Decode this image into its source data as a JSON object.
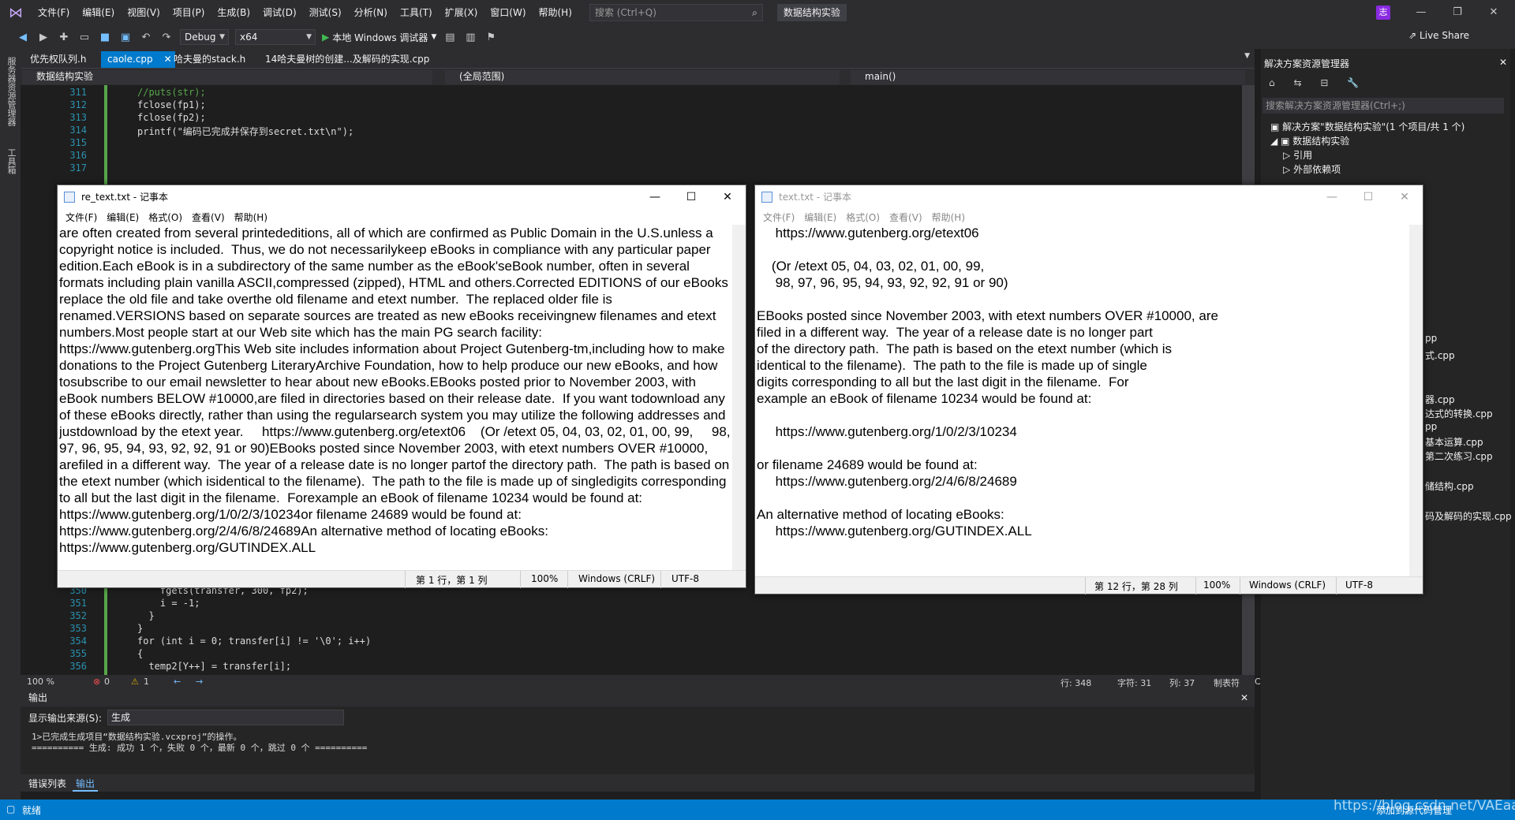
{
  "menu": {
    "items": [
      "文件(F)",
      "编辑(E)",
      "视图(V)",
      "项目(P)",
      "生成(B)",
      "调试(D)",
      "测试(S)",
      "分析(N)",
      "工具(T)",
      "扩展(X)",
      "窗口(W)",
      "帮助(H)"
    ],
    "search_placeholder": "搜索 (Ctrl+Q)",
    "project_badge": "数据结构实验",
    "user_initial": "志"
  },
  "toolbar": {
    "config": "Debug",
    "platform": "x64",
    "run_label": "本地 Windows 调试器",
    "live_share": "Live Share"
  },
  "left_rail": {
    "server_explorer": "服务器资源管理器",
    "toolbox": "工具箱"
  },
  "tabs": [
    {
      "label": "优先权队列.h"
    },
    {
      "label": "caole.cpp"
    },
    {
      "label": "哈夫曼的stack.h"
    },
    {
      "label": "14哈夫曼树的创建...及解码的实现.cpp"
    }
  ],
  "navbar": {
    "project": "数据结构实验",
    "scope": "(全局范围)",
    "function": "main()"
  },
  "editor": {
    "top_lines": [
      {
        "n": "311",
        "code": "//puts(str);"
      },
      {
        "n": "312",
        "code": "fclose(fp1);"
      },
      {
        "n": "313",
        "code": "fclose(fp2);"
      },
      {
        "n": "314",
        "code": "printf(\"编码已完成并保存到secret.txt\\n\");"
      },
      {
        "n": "315",
        "code": ""
      },
      {
        "n": "316",
        "code": ""
      },
      {
        "n": "317",
        "code": ""
      }
    ],
    "bottom_lines": [
      {
        "n": "350",
        "code": "    fgets(transfer, 300, fp2);"
      },
      {
        "n": "351",
        "code": "    i = -1;"
      },
      {
        "n": "352",
        "code": "  }"
      },
      {
        "n": "353",
        "code": "}"
      },
      {
        "n": "354",
        "code": "for (int i = 0; transfer[i] != '\\0'; i++)"
      },
      {
        "n": "355",
        "code": "{"
      },
      {
        "n": "356",
        "code": "  temp2[Y++] = transfer[i];"
      }
    ],
    "status": {
      "zoom": "100 %",
      "errors": "0",
      "warnings": "1",
      "line": "行: 348",
      "char": "字符: 31",
      "col": "列: 37",
      "tabs": "制表符",
      "eol": "CRLF"
    }
  },
  "output": {
    "title": "输出",
    "source_label": "显示输出来源(S):",
    "source_value": "生成",
    "lines": [
      "1>已完成生成项目“数据结构实验.vcxproj”的操作。",
      "========== 生成: 成功 1 个，失败 0 个，最新 0 个，跳过 0 个 =========="
    ]
  },
  "bottom_tabs": [
    "错误列表",
    "输出"
  ],
  "solution": {
    "title": "解决方案资源管理器",
    "search_placeholder": "搜索解决方案资源管理器(Ctrl+;)",
    "root": "解决方案\"数据结构实验\"(1 个项目/共 1 个)",
    "project": "数据结构实验",
    "refs": "引用",
    "external": "外部依赖项",
    "files": [
      "pp",
      "式.cpp",
      "器.cpp",
      "达式的转换.cpp",
      "pp",
      "基本运算.cpp",
      "第二次练习.cpp",
      "储结构.cpp",
      "码及解码的实现.cpp"
    ]
  },
  "statusbar": {
    "ready": "就绪",
    "add_source": "添加到源代码管理",
    "watermark": "https://blog.csdn.net/VAEaaaa"
  },
  "notepad1": {
    "title": "re_text.txt - 记事本",
    "menu": [
      "文件(F)",
      "编辑(E)",
      "格式(O)",
      "查看(V)",
      "帮助(H)"
    ],
    "content": "are often created from several printededitions, all of which are confirmed as Public Domain in the U.S.unless a copyright notice is included.  Thus, we do not necessarilykeep eBooks in compliance with any particular paper edition.Each eBook is in a subdirectory of the same number as the eBook'seBook number, often in several formats including plain vanilla ASCII,compressed (zipped), HTML and others.Corrected EDITIONS of our eBooks replace the old file and take overthe old filename and etext number.  The replaced older file is renamed.VERSIONS based on separate sources are treated as new eBooks receivingnew filenames and etext numbers.Most people start at our Web site which has the main PG search facility:    https://www.gutenberg.orgThis Web site includes information about Project Gutenberg-tm,including how to make donations to the Project Gutenberg LiteraryArchive Foundation, how to help produce our new eBooks, and how tosubscribe to our email newsletter to hear about new eBooks.EBooks posted prior to November 2003, with eBook numbers BELOW #10000,are filed in directories based on their release date.  If you want todownload any of these eBooks directly, rather than using the regularsearch system you may utilize the following addresses and justdownload by the etext year.     https://www.gutenberg.org/etext06    (Or /etext 05, 04, 03, 02, 01, 00, 99,     98, 97, 96, 95, 94, 93, 92, 92, 91 or 90)EBooks posted since November 2003, with etext numbers OVER #10000, arefiled in a different way.  The year of a release date is no longer partof the directory path.  The path is based on the etext number (which isidentical to the filename).  The path to the file is made up of singledigits corresponding to all but the last digit in the filename.  Forexample an eBook of filename 10234 would be found at:     https://www.gutenberg.org/1/0/2/3/10234or filename 24689 would be found at:     https://www.gutenberg.org/2/4/6/8/24689An alternative method of locating eBooks:     https://www.gutenberg.org/GUTINDEX.ALL",
    "pos": "第 1 行，第 1 列",
    "zoom": "100%",
    "eol": "Windows (CRLF)",
    "enc": "UTF-8"
  },
  "notepad2": {
    "title": "text.txt - 记事本",
    "menu": [
      "文件(F)",
      "编辑(E)",
      "格式(O)",
      "查看(V)",
      "帮助(H)"
    ],
    "content": "     https://www.gutenberg.org/etext06\n\n    (Or /etext 05, 04, 03, 02, 01, 00, 99,\n     98, 97, 96, 95, 94, 93, 92, 92, 91 or 90)\n\nEBooks posted since November 2003, with etext numbers OVER #10000, are\nfiled in a different way.  The year of a release date is no longer part\nof the directory path.  The path is based on the etext number (which is\nidentical to the filename).  The path to the file is made up of single\ndigits corresponding to all but the last digit in the filename.  For\nexample an eBook of filename 10234 would be found at:\n\n     https://www.gutenberg.org/1/0/2/3/10234\n\nor filename 24689 would be found at:\n     https://www.gutenberg.org/2/4/6/8/24689\n\nAn alternative method of locating eBooks:\n     https://www.gutenberg.org/GUTINDEX.ALL",
    "pos": "第 12 行，第 28 列",
    "zoom": "100%",
    "eol": "Windows (CRLF)",
    "enc": "UTF-8"
  }
}
